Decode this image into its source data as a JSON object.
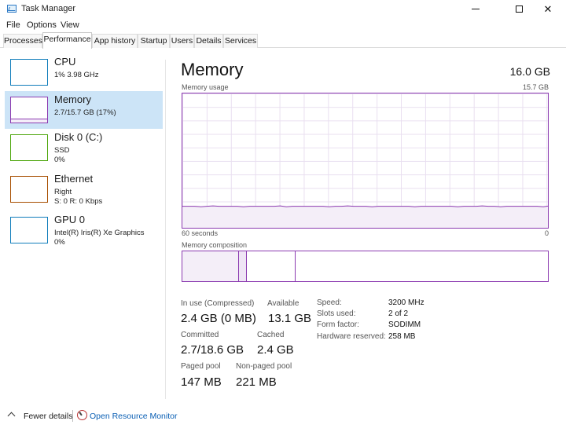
{
  "window": {
    "title": "Task Manager"
  },
  "menu": [
    "File",
    "Options",
    "View"
  ],
  "tabs": [
    "Processes",
    "Performance",
    "App history",
    "Startup",
    "Users",
    "Details",
    "Services"
  ],
  "sidebar": {
    "items": [
      {
        "name": "CPU",
        "line1": "1% 3.98 GHz",
        "line2": "",
        "color": "#117dbb"
      },
      {
        "name": "Memory",
        "line1": "2.7/15.7 GB (17%)",
        "line2": "",
        "color": "#8b12ae",
        "fill_fraction": 0.17
      },
      {
        "name": "Disk 0 (C:)",
        "line1": "SSD",
        "line2": "0%",
        "color": "#4da60c"
      },
      {
        "name": "Ethernet",
        "line1": "Right",
        "line2": "S: 0 R: 0 Kbps",
        "color": "#a74f01"
      },
      {
        "name": "GPU 0",
        "line1": "Intel(R) Iris(R) Xe Graphics",
        "line2": "0%",
        "color": "#117dbb"
      }
    ]
  },
  "main": {
    "title": "Memory",
    "total": "16.0 GB",
    "usage_label": "Memory usage",
    "usage_max": "15.7 GB",
    "time_left": "60 seconds",
    "time_right": "0",
    "usage_fraction": 0.17,
    "composition_label": "Memory composition",
    "stats": {
      "in_use_label": "In use (Compressed)",
      "in_use_value": "2.4 GB (0 MB)",
      "available_label": "Available",
      "available_value": "13.1 GB",
      "committed_label": "Committed",
      "committed_value": "2.7/18.6 GB",
      "cached_label": "Cached",
      "cached_value": "2.4 GB",
      "paged_label": "Paged pool",
      "paged_value": "147 MB",
      "nonpaged_label": "Non-paged pool",
      "nonpaged_value": "221 MB"
    },
    "details": [
      {
        "label": "Speed:",
        "value": "3200 MHz"
      },
      {
        "label": "Slots used:",
        "value": "2 of 2"
      },
      {
        "label": "Form factor:",
        "value": "SODIMM"
      },
      {
        "label": "Hardware reserved:",
        "value": "258 MB"
      }
    ]
  },
  "footer": {
    "fewer_details": "Fewer details",
    "open_monitor": "Open Resource Monitor"
  },
  "colors": {
    "memory_accent": "#8b12ae",
    "selected_bg": "#cce4f7",
    "link": "#0a5fb4"
  }
}
